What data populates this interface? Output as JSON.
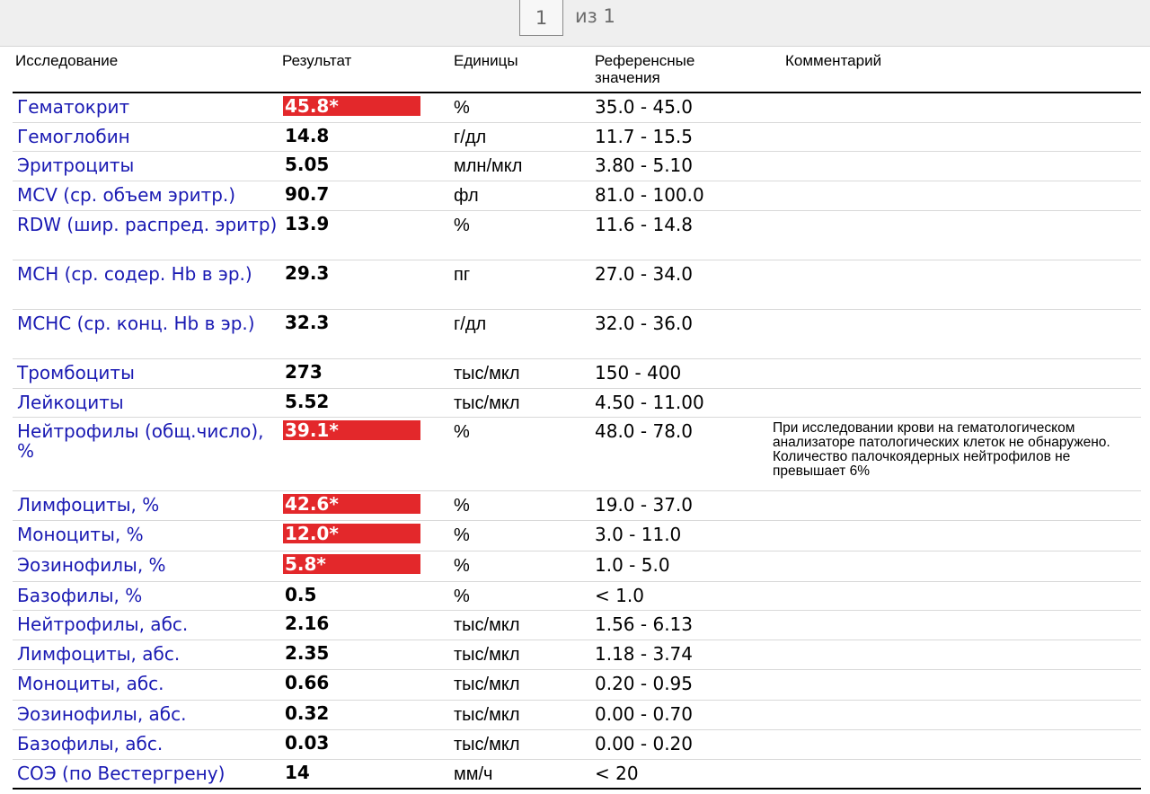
{
  "toolbar": {
    "current_page": "1",
    "of_label": "из 1"
  },
  "headers": {
    "test": "Исследование",
    "result": "Результат",
    "units": "Единицы",
    "reference": "Референсные значения",
    "comment": "Комментарий"
  },
  "rows": [
    {
      "name": "Гематокрит",
      "result": "45.8*",
      "flag": true,
      "unit": "%",
      "ref": "35.0 - 45.0",
      "comment": ""
    },
    {
      "name": "Гемоглобин",
      "result": "14.8",
      "flag": false,
      "unit": "г/дл",
      "ref": "11.7 - 15.5",
      "comment": ""
    },
    {
      "name": "Эритроциты",
      "result": "5.05",
      "flag": false,
      "unit": "млн/мкл",
      "ref": "3.80 - 5.10",
      "comment": ""
    },
    {
      "name": "MCV (ср. объем эритр.)",
      "result": "90.7",
      "flag": false,
      "unit": "фл",
      "ref": "81.0 - 100.0",
      "comment": ""
    },
    {
      "name": "RDW (шир. распред. эритр)",
      "result": "13.9",
      "flag": false,
      "unit": "%",
      "ref": "11.6 - 14.8",
      "comment": ""
    },
    {
      "name": "MCH (ср. содер. Hb в эр.)",
      "result": "29.3",
      "flag": false,
      "unit": "пг",
      "ref": "27.0 - 34.0",
      "comment": ""
    },
    {
      "name": "MCHC (ср. конц. Hb в эр.)",
      "result": "32.3",
      "flag": false,
      "unit": "г/дл",
      "ref": "32.0 - 36.0",
      "comment": ""
    },
    {
      "name": "Тромбоциты",
      "result": "273",
      "flag": false,
      "unit": "тыс/мкл",
      "ref": "150 - 400",
      "comment": ""
    },
    {
      "name": "Лейкоциты",
      "result": "5.52",
      "flag": false,
      "unit": "тыс/мкл",
      "ref": "4.50 - 11.00",
      "comment": ""
    },
    {
      "name": "Нейтрофилы (общ.число), %",
      "result": "39.1*",
      "flag": true,
      "unit": "%",
      "ref": "48.0 - 78.0",
      "comment": "При исследовании крови на гематологическом анализаторе патологических клеток не обнаружено. Количество палочкоядерных нейтрофилов не превышает 6%"
    },
    {
      "name": "Лимфоциты, %",
      "result": "42.6*",
      "flag": true,
      "unit": "%",
      "ref": "19.0 - 37.0",
      "comment": ""
    },
    {
      "name": "Моноциты, %",
      "result": "12.0*",
      "flag": true,
      "unit": "%",
      "ref": "3.0 - 11.0",
      "comment": ""
    },
    {
      "name": "Эозинофилы, %",
      "result": "5.8*",
      "flag": true,
      "unit": "%",
      "ref": "1.0 - 5.0",
      "comment": ""
    },
    {
      "name": "Базофилы, %",
      "result": "0.5",
      "flag": false,
      "unit": "%",
      "ref": "< 1.0",
      "comment": ""
    },
    {
      "name": "Нейтрофилы, абс.",
      "result": "2.16",
      "flag": false,
      "unit": "тыс/мкл",
      "ref": "1.56 - 6.13",
      "comment": ""
    },
    {
      "name": "Лимфоциты, абс.",
      "result": "2.35",
      "flag": false,
      "unit": "тыс/мкл",
      "ref": "1.18 - 3.74",
      "comment": ""
    },
    {
      "name": "Моноциты, абс.",
      "result": "0.66",
      "flag": false,
      "unit": "тыс/мкл",
      "ref": "0.20 - 0.95",
      "comment": ""
    },
    {
      "name": "Эозинофилы, абс.",
      "result": "0.32",
      "flag": false,
      "unit": "тыс/мкл",
      "ref": "0.00 - 0.70",
      "comment": ""
    },
    {
      "name": "Базофилы, абс.",
      "result": "0.03",
      "flag": false,
      "unit": "тыс/мкл",
      "ref": "0.00 - 0.20",
      "comment": ""
    },
    {
      "name": "СОЭ (по Вестергрену)",
      "result": "14",
      "flag": false,
      "unit": "мм/ч",
      "ref": "< 20",
      "comment": ""
    }
  ]
}
